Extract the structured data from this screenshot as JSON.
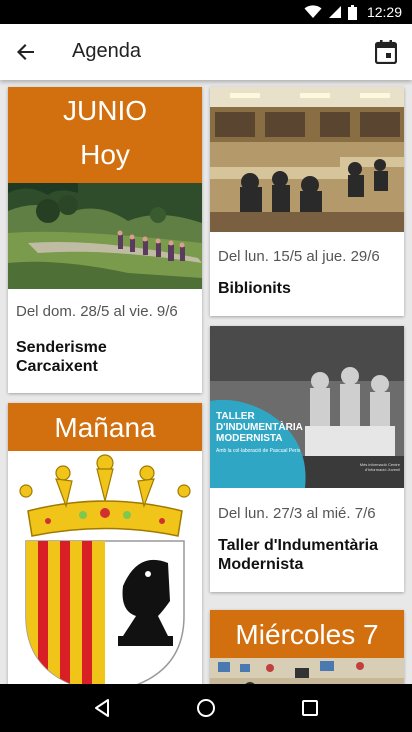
{
  "status": {
    "time": "12:29"
  },
  "app_bar": {
    "title": "Agenda"
  },
  "left_column": [
    {
      "month": "JUNIO",
      "day_label": "Hoy",
      "date_range": "Del dom. 28/5 al vie. 9/6",
      "title": "Senderisme Carcaixent"
    },
    {
      "day_label": "Mañana"
    }
  ],
  "right_column": [
    {
      "date_range": "Del lun. 15/5 al jue. 29/6",
      "title": "Biblionits"
    },
    {
      "date_range": "Del lun. 27/3 al mié. 7/6",
      "title": "Taller d'Indumentària Modernista",
      "poster_text": {
        "line1": "TALLER",
        "line2": "D'INDUMENTÀRIA",
        "line3": "MODERNISTA",
        "line4": "Amb la col·laboració de Pascual Peris",
        "right_note": "Més informació Centre d'Informació Juvenil"
      }
    },
    {
      "day_label": "Miércoles 7"
    }
  ],
  "colors": {
    "accent": "#d2700f",
    "background": "#e8e8e8"
  }
}
